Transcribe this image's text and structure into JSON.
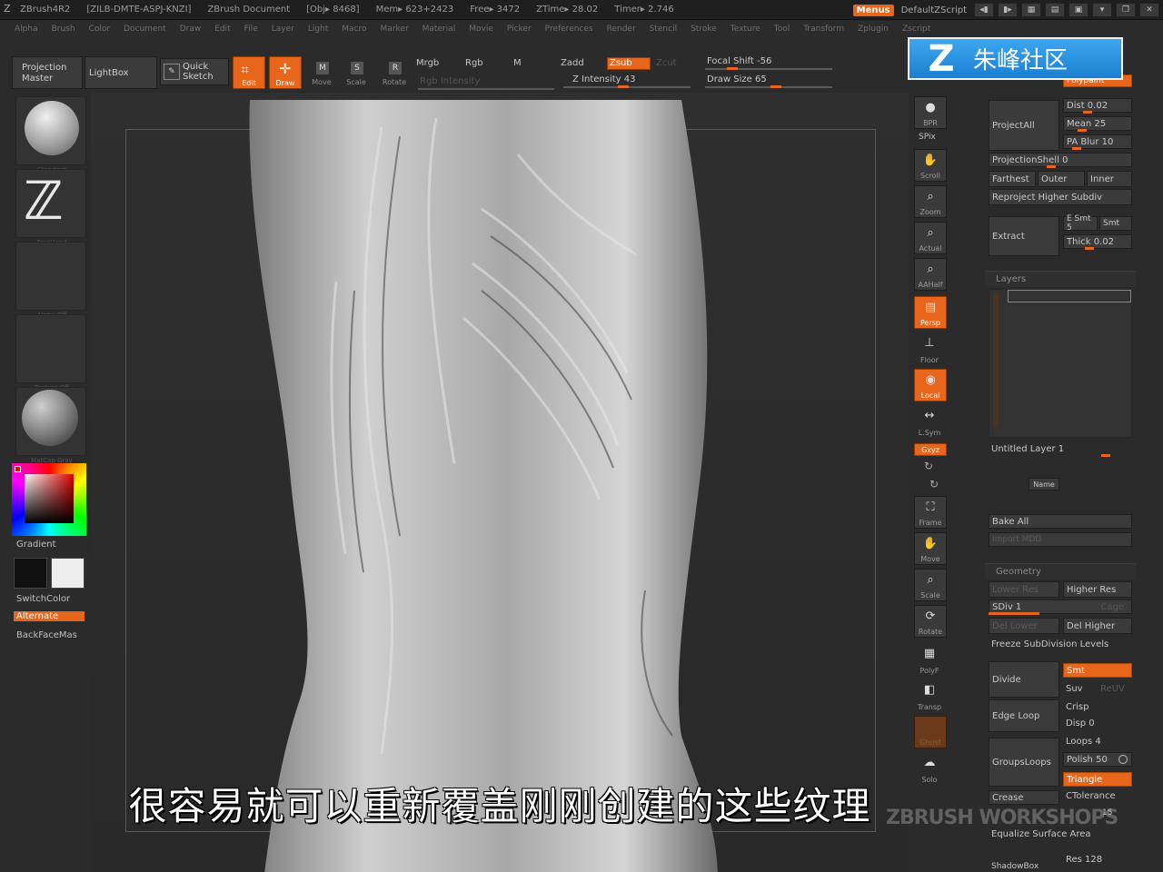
{
  "titlebar": {
    "app": "ZBrush4R2",
    "build": "[ZILB-DMTE-ASPJ-KNZI]",
    "document": "ZBrush Document",
    "obj": "[Obj▸ 8468]",
    "mem": "Mem▸ 623+2423",
    "free": "Free▸ 3472",
    "ztime": "ZTime▸ 28.02",
    "timer": "Timer▸ 2.746",
    "menus_label": "Menus",
    "script_label": "DefaultZScript"
  },
  "menubar": [
    "Alpha",
    "Brush",
    "Color",
    "Document",
    "Draw",
    "Edit",
    "File",
    "Layer",
    "Light",
    "Macro",
    "Marker",
    "Material",
    "Movie",
    "Picker",
    "Preferences",
    "Render",
    "Stencil",
    "Stroke",
    "Texture",
    "Tool",
    "Transform",
    "Zplugin",
    "Zscript"
  ],
  "toolbar": {
    "projection_master": "Projection Master",
    "lightbox": "LightBox",
    "quick_sketch": "Quick Sketch",
    "edit": "Edit",
    "draw": "Draw",
    "move": "Move",
    "scale": "Scale",
    "rotate": "Rotate",
    "mrgb": "Mrgb",
    "rgb": "Rgb",
    "m": "M",
    "zadd": "Zadd",
    "zsub": "Zsub",
    "zcut": "Zcut",
    "rgb_intensity": "Rgb Intensity",
    "z_intensity": "Z Intensity 43",
    "focal_shift": "Focal Shift -56",
    "draw_size": "Draw Size 65"
  },
  "leftshelf": {
    "brush_cap": "Standard",
    "stroke_cap": "FreeHand",
    "alpha_cap": "Alpha Off",
    "texture_cap": "Texture Off",
    "material_cap": "MatCap Gray",
    "gradient": "Gradient",
    "switchcolor": "SwitchColor",
    "alternate": "Alternate",
    "backfacemask": "BackFaceMas"
  },
  "rightshelf": {
    "bpr": "BPR",
    "spix": "SPix",
    "scroll": "Scroll",
    "zoom": "Zoom",
    "actual": "Actual",
    "aahalf": "AAHalf",
    "persp": "Persp",
    "floor": "Floor",
    "local": "Local",
    "lsym": "L.Sym",
    "xyz": "Gxyz",
    "frame": "Frame",
    "move": "Move",
    "scale": "Scale",
    "rotate": "Rotate",
    "polyf": "PolyF",
    "transp": "Transp",
    "ghost": "Ghost",
    "solo": "Solo"
  },
  "rpanel": {
    "polypaint": "Polypaint",
    "dist": "Dist 0.02",
    "mean": "Mean 25",
    "pa_blur": "PA Blur 10",
    "projectall": "ProjectAll",
    "projectionshell": "ProjectionShell 0",
    "farthest": "Farthest",
    "outer": "Outer",
    "inner": "Inner",
    "reproject": "Reproject Higher Subdiv",
    "extract": "Extract",
    "e_smt": "E Smt 5",
    "s_smt": "Smt",
    "thick": "Thick 0.02",
    "layers": "Layers",
    "untitled_layer": "Untitled Layer 1",
    "name": "Name",
    "bake_all": "Bake All",
    "import_mdd": "Import MDD",
    "geometry": "Geometry",
    "lower_res": "Lower Res",
    "higher_res": "Higher Res",
    "sdiv": "SDiv 1",
    "cage": "Cage",
    "del_lower": "Del Lower",
    "del_higher": "Del Higher",
    "freeze": "Freeze SubDivision Levels",
    "divide": "Divide",
    "smt": "Smt",
    "suv": "Suv",
    "reuv": "ReUV",
    "edge_loop": "Edge Loop",
    "crisp": "Crisp",
    "disp": "Disp 0",
    "groupsloops": "GroupsLoops",
    "loops": "Loops 4",
    "polish": "Polish 50",
    "triangle": "Triangle",
    "crease": "Crease",
    "ctolerance": "CTolerance",
    "crease_lvl": "15",
    "equalize": "Equalize Surface Area",
    "shadowbox": "ShadowBox",
    "res": "Res 128"
  },
  "subtitle": "很容易就可以重新覆盖刚刚创建的这些纹理",
  "watermark": {
    "brand": "朱峰社区",
    "workshops": "ZBRUSH WORKSHOPS"
  },
  "colors": {
    "accent": "#e8661b",
    "logo_bg": "#1a7fd1",
    "canvas_bg": "#2f2f2f"
  }
}
